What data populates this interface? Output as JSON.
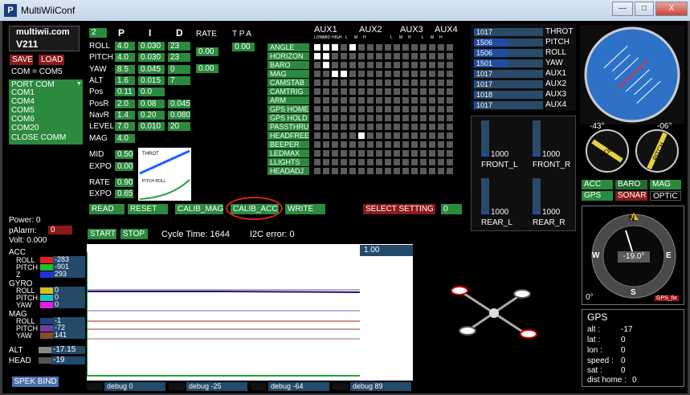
{
  "window": {
    "title": "MultiWiiConf",
    "icon": "P",
    "min": "—",
    "max": "□",
    "close": "X"
  },
  "brand": {
    "name": "multiwii.com",
    "version": "V211"
  },
  "conn": {
    "save": "SAVE",
    "load": "LOAD",
    "com_status": "COM = COM5",
    "port_label": "PORT COM",
    "ports": [
      "COM1",
      "COM4",
      "COM5",
      "COM6",
      "COM20"
    ],
    "close": "CLOSE COMM"
  },
  "pid": {
    "headers": [
      "P",
      "I",
      "D",
      "RATE",
      "T P A"
    ],
    "selector": "2",
    "rows": [
      {
        "name": "ROLL",
        "p": "4.0",
        "i": "0.030",
        "d": "23"
      },
      {
        "name": "PITCH",
        "p": "4.0",
        "i": "0.030",
        "d": "23"
      },
      {
        "name": "YAW",
        "p": "8.5",
        "i": "0.045",
        "d": "0"
      },
      {
        "name": "ALT",
        "p": "1.6",
        "i": "0.015",
        "d": "7"
      },
      {
        "name": "Pos",
        "p": "0.11",
        "i": "0.0",
        "d": ""
      },
      {
        "name": "PosR",
        "p": "2.0",
        "i": "0.08",
        "d": "0.045"
      },
      {
        "name": "NavR",
        "p": "1.4",
        "i": "0.20",
        "d": "0.080"
      },
      {
        "name": "LEVEL",
        "p": "7.0",
        "i": "0.010",
        "d": "20"
      },
      {
        "name": "MAG",
        "p": "4.0",
        "i": "",
        "d": ""
      }
    ],
    "rate_rp": "0.00",
    "rate_yaw": "0.00",
    "tpa": "0.00"
  },
  "curves": {
    "mid_label": "MID",
    "mid": "0.50",
    "expo_label": "EXPO",
    "expo": "0.00",
    "throt": "THROT",
    "rate_label": "RATE",
    "rate": "0.90",
    "expo2_label": "EXPO",
    "expo2": "0.65",
    "pr": "PITCH\nROLL"
  },
  "aux": {
    "groups": [
      "AUX1",
      "AUX2",
      "AUX3",
      "AUX4"
    ],
    "sub": [
      "LOW",
      "MID",
      "HIGH",
      "L",
      "M",
      "H",
      "L",
      "M",
      "H",
      "L",
      "M",
      "H"
    ],
    "modes": [
      "ANGLE",
      "HORIZON",
      "BARO",
      "MAG",
      "CAMSTAB",
      "CAMTRIG",
      "ARM",
      "GPS HOME",
      "GPS HOLD",
      "PASSTHRU",
      "HEADFREE",
      "BEEPER",
      "LEDMAX",
      "LLIGHTS",
      "HEADADJ"
    ]
  },
  "buttons": {
    "read": "READ",
    "reset": "RESET",
    "calib_mag": "CALIB_MAG",
    "calib_acc": "CALIB_ACC",
    "write": "WRITE",
    "select_setting": "SELECT SETTING",
    "setting_val": "0",
    "start": "START",
    "stop": "STOP",
    "spek_bind": "SPEK BIND"
  },
  "status": {
    "cycle": "Cycle Time: 1644",
    "i2c": "I2C error: 0"
  },
  "power": {
    "power": "Power: 0",
    "palarm": "pAlarm:",
    "palarm_val": "0",
    "volt": "Volt: 0.000"
  },
  "sensors": {
    "acc": "ACC",
    "acc_roll": "ROLL",
    "acc_roll_v": "-283",
    "acc_pitch": "PITCH",
    "acc_pitch_v": "-901",
    "acc_z": "Z",
    "acc_z_v": "293",
    "gyro": "GYRO",
    "g_roll": "ROLL",
    "g_roll_v": "0",
    "g_pitch": "PITCH",
    "g_pitch_v": "0",
    "g_yaw": "YAW",
    "g_yaw_v": "0",
    "mag": "MAG",
    "m_roll": "ROLL",
    "m_roll_v": "-1",
    "m_pitch": "PITCH",
    "m_pitch_v": "-72",
    "m_yaw": "YAW",
    "m_yaw_v": "141",
    "alt": "ALT",
    "alt_v": "-17.15",
    "head": "HEAD",
    "head_v": "-19"
  },
  "graph": {
    "scale": "1.00",
    "debug": [
      "debug 0",
      "debug -25",
      "debug -64",
      "debug 89"
    ]
  },
  "rc": [
    {
      "v": "1017",
      "n": "THROT",
      "f": 0.02
    },
    {
      "v": "1506",
      "n": "PITCH",
      "f": 0.5
    },
    {
      "v": "1506",
      "n": "ROLL",
      "f": 0.5
    },
    {
      "v": "1501",
      "n": "YAW",
      "f": 0.5
    },
    {
      "v": "1017",
      "n": "AUX1",
      "f": 0.02
    },
    {
      "v": "1017",
      "n": "AUX2",
      "f": 0.02
    },
    {
      "v": "1018",
      "n": "AUX3",
      "f": 0.02
    },
    {
      "v": "1017",
      "n": "AUX4",
      "f": 0.02
    }
  ],
  "motors": [
    {
      "v": "1000",
      "n": "FRONT_L"
    },
    {
      "v": "1000",
      "n": "FRONT_R"
    },
    {
      "v": "1000",
      "n": "REAR_L"
    },
    {
      "v": "1000",
      "n": "REAR_R"
    }
  ],
  "att": {
    "roll": "-43°",
    "pitch": "-06°",
    "roll_lbl": "ROLL",
    "pitch_lbl": "PITCH"
  },
  "sens_ind": {
    "acc": "ACC",
    "baro": "BARO",
    "mag": "MAG",
    "gps": "GPS",
    "sonar": "SONAR",
    "optic": "OPTIC"
  },
  "compass": {
    "n": "N",
    "e": "E",
    "s": "S",
    "w": "W",
    "heading": "-19.0°",
    "zero": "0°",
    "gps_fix": "GPS_fix"
  },
  "gps": {
    "title": "GPS",
    "alt": "alt :",
    "alt_v": "-17",
    "lat": "lat :",
    "lat_v": "0",
    "lon": "lon :",
    "lon_v": "0",
    "speed": "speed :",
    "speed_v": "0",
    "sat": "sat :",
    "sat_v": "0",
    "dist": "dist home :",
    "dist_v": "0"
  }
}
